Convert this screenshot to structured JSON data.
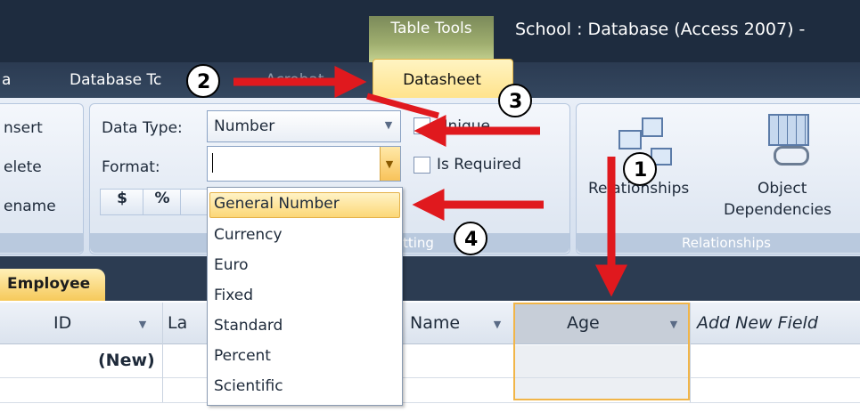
{
  "window": {
    "context_tab": "Table Tools",
    "title": "School : Database (Access 2007) -"
  },
  "ribbon_tabs": {
    "partial_left": "a",
    "database_tools": "Database Tc",
    "external_data_partial": "Acrobat",
    "datasheet": "Datasheet"
  },
  "fields_columns_group": {
    "insert": "nsert",
    "delete": "elete",
    "rename": "ename"
  },
  "data_type_formatting": {
    "data_type_label": "Data Type:",
    "data_type_value": "Number",
    "format_label": "Format:",
    "format_value": "",
    "unique_label": "Unique",
    "is_required_label": "Is Required",
    "currency_btn": "$",
    "percent_btn": "%",
    "group_caption": "tting"
  },
  "relationships_group": {
    "relationships_btn": "Relationships",
    "object_dependencies_line1": "Object",
    "object_dependencies_line2": "Dependencies",
    "group_caption": "Relationships"
  },
  "format_dropdown": {
    "items": [
      "General Number",
      "Currency",
      "Euro",
      "Fixed",
      "Standard",
      "Percent",
      "Scientific"
    ],
    "highlighted": "General Number"
  },
  "document_tab": "Employee",
  "table": {
    "headers": {
      "id": "ID",
      "last_name_partial": "La",
      "first_name_partial": "Name",
      "age": "Age",
      "add_new": "Add New Field"
    },
    "new_row_label": "(New)"
  },
  "annotations": {
    "markers": [
      "1",
      "2",
      "3",
      "4"
    ],
    "arrow_color": "#e0191e"
  },
  "colors": {
    "title_bar": "#1e2c3f",
    "ribbon": "#dfe7f2",
    "highlight": "#fcd777",
    "accent_border": "#f1b548"
  }
}
